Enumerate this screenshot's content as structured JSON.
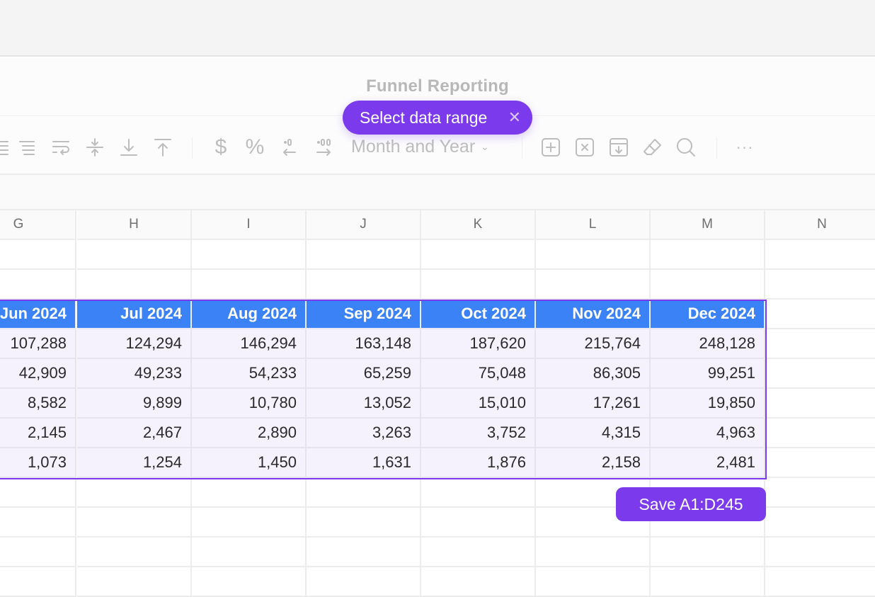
{
  "document": {
    "title": "Funnel Reporting"
  },
  "range_pill": {
    "label": "Select data range",
    "close_icon": "close-icon"
  },
  "toolbar": {
    "icons": [
      "align-right-icon",
      "align-justify-icon",
      "wrap-text-icon",
      "vertical-align-middle-icon",
      "vertical-align-bottom-icon",
      "vertical-align-top-icon",
      "currency-icon",
      "percent-icon",
      "decrease-decimal-icon",
      "increase-decimal-icon",
      "insert-row-icon",
      "delete-icon",
      "insert-below-icon",
      "clear-format-eraser-icon",
      "search-icon",
      "more-options-icon"
    ],
    "currency_symbol": "$",
    "percent_symbol": "%",
    "format_dropdown": "Month and Year",
    "more": "···"
  },
  "grid": {
    "columns": [
      "G",
      "H",
      "I",
      "J",
      "K",
      "L",
      "M",
      "N"
    ],
    "header_row": [
      "Jun 2024",
      "Jul 2024",
      "Aug 2024",
      "Sep 2024",
      "Oct 2024",
      "Nov 2024",
      "Dec 2024"
    ],
    "rows": [
      [
        "107,288",
        "124,294",
        "146,294",
        "163,148",
        "187,620",
        "215,764",
        "248,128"
      ],
      [
        "42,909",
        "49,233",
        "54,233",
        "65,259",
        "75,048",
        "86,305",
        "99,251"
      ],
      [
        "8,582",
        "9,899",
        "10,780",
        "13,052",
        "15,010",
        "17,261",
        "19,850"
      ],
      [
        "2,145",
        "2,467",
        "2,890",
        "3,263",
        "3,752",
        "4,315",
        "4,963"
      ],
      [
        "1,073",
        "1,254",
        "1,450",
        "1,631",
        "1,876",
        "2,158",
        "2,481"
      ]
    ]
  },
  "save_button": {
    "label": "Save A1:D245"
  },
  "colors": {
    "accent": "#7c3aed",
    "header_fill": "#3b82f6",
    "selection_fill": "#f5f2fd"
  }
}
